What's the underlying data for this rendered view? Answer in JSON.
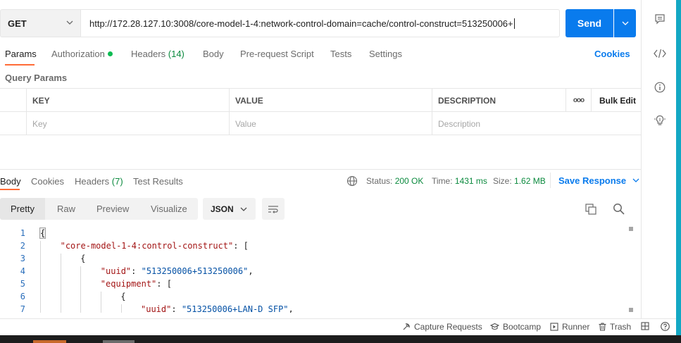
{
  "request": {
    "method": "GET",
    "url": "http://172.28.127.10:3008/core-model-1-4:network-control-domain=cache/control-construct=513250006+",
    "send_label": "Send"
  },
  "request_tabs": {
    "params": "Params",
    "authorization": "Authorization",
    "headers": "Headers",
    "headers_count": "(14)",
    "body": "Body",
    "pre_request": "Pre-request Script",
    "tests": "Tests",
    "settings": "Settings",
    "cookies": "Cookies"
  },
  "query_params": {
    "title": "Query Params",
    "columns": [
      "KEY",
      "VALUE",
      "DESCRIPTION"
    ],
    "more": "ooo",
    "bulk_edit": "Bulk Edit",
    "placeholders": [
      "Key",
      "Value",
      "Description"
    ]
  },
  "response_tabs": {
    "body": "Body",
    "cookies": "Cookies",
    "headers": "Headers",
    "headers_count": "(7)",
    "test_results": "Test Results"
  },
  "response_meta": {
    "status_label": "Status:",
    "status_value": "200 OK",
    "time_label": "Time:",
    "time_value": "1431 ms",
    "size_label": "Size:",
    "size_value": "1.62 MB",
    "save_response": "Save Response"
  },
  "response_view": {
    "modes": [
      "Pretty",
      "Raw",
      "Preview",
      "Visualize"
    ],
    "active_mode": "Pretty",
    "format": "JSON"
  },
  "code_lines": [
    {
      "n": "1",
      "indent": 0,
      "parts": [
        [
          "p",
          "{"
        ]
      ]
    },
    {
      "n": "2",
      "indent": 1,
      "parts": [
        [
          "k",
          "\"core-model-1-4:control-construct\""
        ],
        [
          "p",
          ": ["
        ]
      ]
    },
    {
      "n": "3",
      "indent": 2,
      "parts": [
        [
          "p",
          "{"
        ]
      ]
    },
    {
      "n": "4",
      "indent": 3,
      "parts": [
        [
          "k",
          "\"uuid\""
        ],
        [
          "p",
          ": "
        ],
        [
          "s",
          "\"513250006+513250006\""
        ],
        [
          "p",
          ","
        ]
      ]
    },
    {
      "n": "5",
      "indent": 3,
      "parts": [
        [
          "k",
          "\"equipment\""
        ],
        [
          "p",
          ": ["
        ]
      ]
    },
    {
      "n": "6",
      "indent": 4,
      "parts": [
        [
          "p",
          "{"
        ]
      ]
    },
    {
      "n": "7",
      "indent": 5,
      "parts": [
        [
          "k",
          "\"uuid\""
        ],
        [
          "p",
          ": "
        ],
        [
          "s",
          "\"513250006+LAN-D_SFP\""
        ],
        [
          "p",
          ","
        ]
      ]
    }
  ],
  "statusbar": {
    "capture": "Capture Requests",
    "bootcamp": "Bootcamp",
    "runner": "Runner",
    "trash": "Trash"
  },
  "colors": {
    "accent": "#097bed",
    "tab_underline": "#ff6c37",
    "success": "#0b8a3e",
    "json_key": "#a31515",
    "json_string": "#0451a5"
  },
  "icons": [
    "chevron-down-icon",
    "comment-icon",
    "code-icon",
    "info-icon",
    "lightbulb-icon",
    "globe-icon",
    "wrap-lines-icon",
    "copy-icon",
    "search-icon",
    "capture-icon",
    "bootcamp-icon",
    "runner-icon",
    "trash-icon",
    "two-pane-icon",
    "help-icon"
  ]
}
